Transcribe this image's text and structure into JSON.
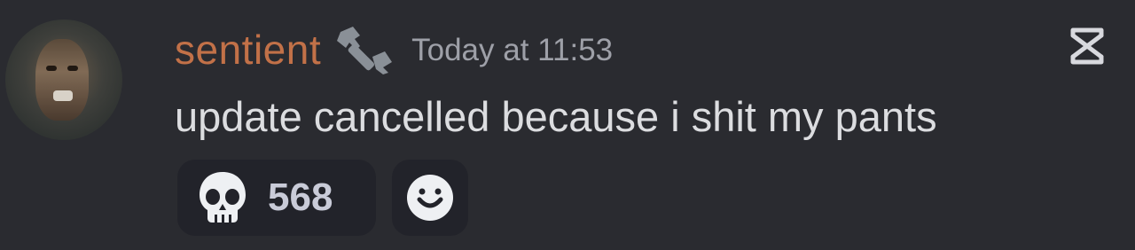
{
  "message": {
    "author": "sentient",
    "author_color": "#c27148",
    "role_icon": "wrench-icon",
    "timestamp": "Today at 11:53",
    "content": "update cancelled because i shit my pants"
  },
  "reactions": [
    {
      "emoji": "skull-icon",
      "count": "568"
    },
    {
      "emoji": "add-reaction-icon"
    }
  ],
  "overlay": {
    "corner_icon": "capcut-logo-icon"
  },
  "colors": {
    "background": "#2a2b30",
    "reaction_bg": "#22232a",
    "text": "#dcdde0",
    "muted": "#9ea0a8"
  }
}
